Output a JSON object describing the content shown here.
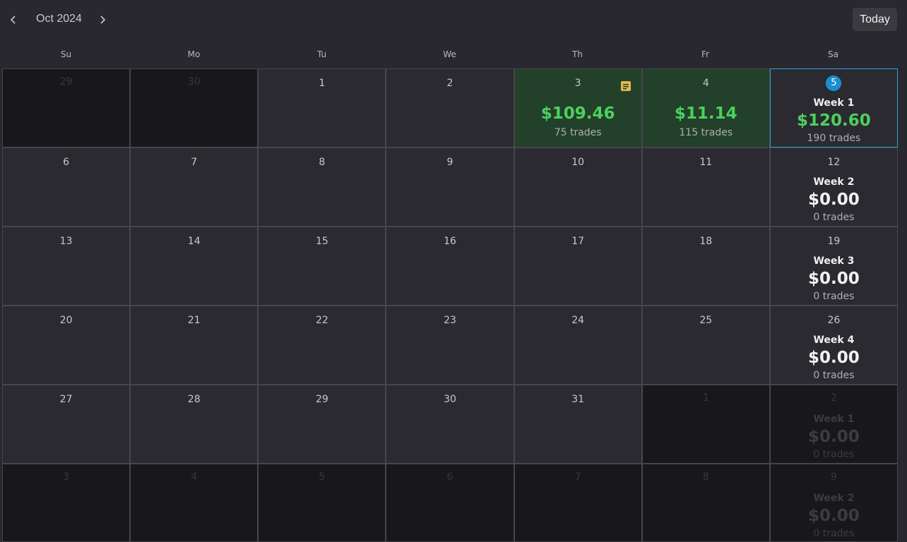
{
  "header": {
    "month": "Oct 2024",
    "today_label": "Today"
  },
  "weekdays": [
    "Su",
    "Mo",
    "Tu",
    "We",
    "Th",
    "Fr",
    "Sa"
  ],
  "weeks": [
    {
      "days": [
        {
          "n": "29",
          "outside": true
        },
        {
          "n": "30",
          "outside": true
        },
        {
          "n": "1"
        },
        {
          "n": "2"
        },
        {
          "n": "3",
          "profit": true,
          "amount": "$109.46",
          "trades": "75 trades",
          "note": true
        },
        {
          "n": "4",
          "profit": true,
          "amount": "$11.14",
          "trades": "115 trades"
        },
        {
          "n": "5",
          "current": true,
          "week": "Week 1",
          "week_amount": "$120.60",
          "week_trades": "190 trades",
          "positive": true
        }
      ]
    },
    {
      "days": [
        {
          "n": "6"
        },
        {
          "n": "7"
        },
        {
          "n": "8"
        },
        {
          "n": "9"
        },
        {
          "n": "10"
        },
        {
          "n": "11"
        },
        {
          "n": "12",
          "week": "Week 2",
          "week_amount": "$0.00",
          "week_trades": "0 trades"
        }
      ]
    },
    {
      "days": [
        {
          "n": "13"
        },
        {
          "n": "14"
        },
        {
          "n": "15"
        },
        {
          "n": "16"
        },
        {
          "n": "17"
        },
        {
          "n": "18"
        },
        {
          "n": "19",
          "week": "Week 3",
          "week_amount": "$0.00",
          "week_trades": "0 trades"
        }
      ]
    },
    {
      "days": [
        {
          "n": "20"
        },
        {
          "n": "21"
        },
        {
          "n": "22"
        },
        {
          "n": "23"
        },
        {
          "n": "24"
        },
        {
          "n": "25"
        },
        {
          "n": "26",
          "week": "Week 4",
          "week_amount": "$0.00",
          "week_trades": "0 trades"
        }
      ]
    },
    {
      "days": [
        {
          "n": "27"
        },
        {
          "n": "28"
        },
        {
          "n": "29"
        },
        {
          "n": "30"
        },
        {
          "n": "31"
        },
        {
          "n": "1",
          "outside": true
        },
        {
          "n": "2",
          "outside": true,
          "week": "Week 1",
          "week_amount": "$0.00",
          "week_trades": "0 trades"
        }
      ]
    },
    {
      "days": [
        {
          "n": "3",
          "outside": true
        },
        {
          "n": "4",
          "outside": true
        },
        {
          "n": "5",
          "outside": true
        },
        {
          "n": "6",
          "outside": true
        },
        {
          "n": "7",
          "outside": true
        },
        {
          "n": "8",
          "outside": true
        },
        {
          "n": "9",
          "outside": true,
          "week": "Week 2",
          "week_amount": "$0.00",
          "week_trades": "0 trades"
        }
      ]
    }
  ],
  "icons": {
    "prev": "chevron-left-icon",
    "next": "chevron-right-icon",
    "note": "note-icon"
  },
  "colors": {
    "profit_bg": "#23402a",
    "profit_text": "#4cd05e",
    "today_accent": "#1a8fd0",
    "note": "#e8b84a"
  }
}
